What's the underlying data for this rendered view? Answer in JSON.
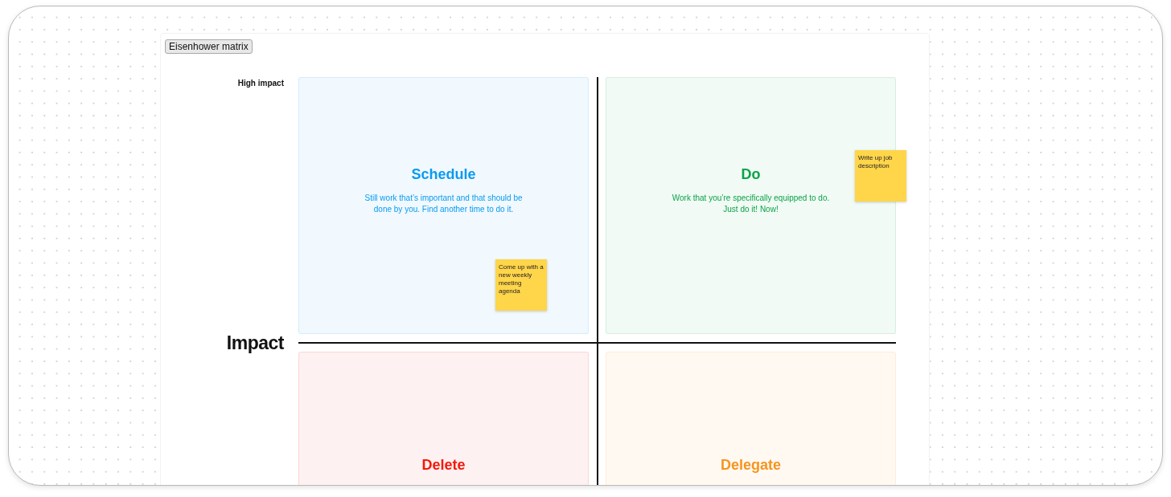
{
  "board": {
    "title_button": "Eisenhower matrix",
    "row_label": "High impact",
    "axis_label": "Impact"
  },
  "quadrants": [
    {
      "title": "Schedule",
      "color": "#0a9bf0",
      "description": "Still work that’s important and that should be done by you. Find another time to do it.",
      "stickies": [
        {
          "text": "Come up with a new weekly meeting agenda"
        }
      ]
    },
    {
      "title": "Do",
      "color": "#0ba34a",
      "description": "Work that you’re specifically equipped to do. Just do it! Now!",
      "stickies": [
        {
          "text": "Write up job description"
        }
      ]
    },
    {
      "title": "Delete",
      "color": "#f5190a"
    },
    {
      "title": "Delegate",
      "color": "#f7941d"
    }
  ]
}
